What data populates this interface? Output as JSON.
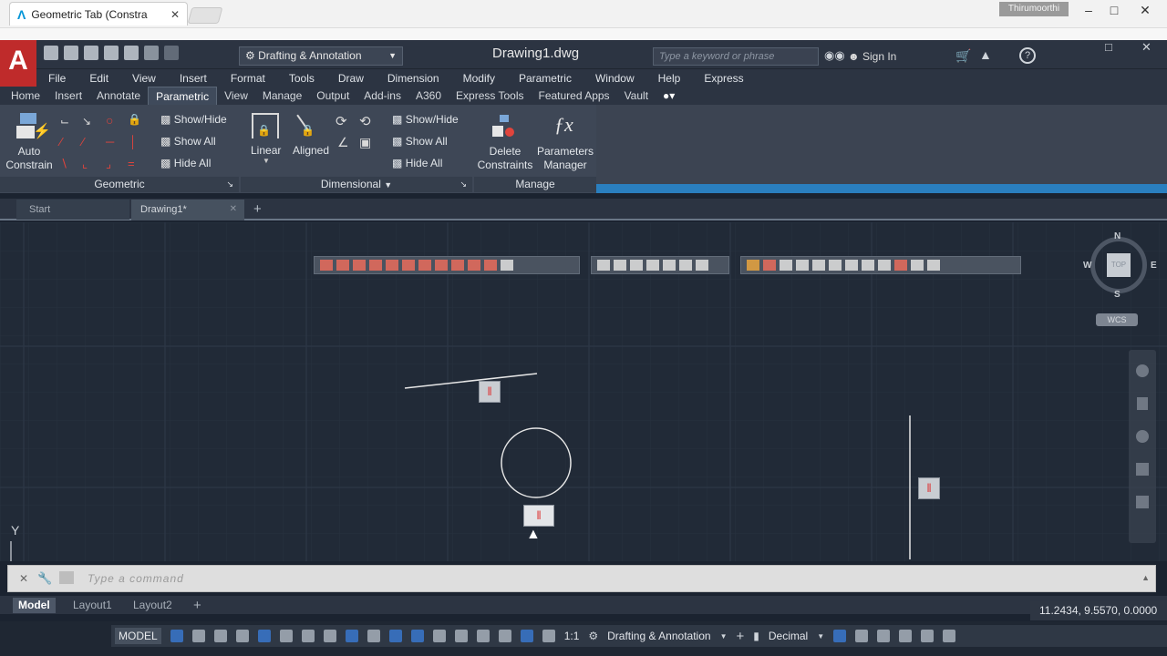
{
  "browser": {
    "tab_title": "Geometric Tab (Constra",
    "user": "Thirumoorthi"
  },
  "app": {
    "logo": "A",
    "workspace": "Drafting & Annotation",
    "document_title": "Drawing1.dwg",
    "search_placeholder": "Type a keyword or phrase",
    "sign_in": "Sign In"
  },
  "menu": [
    "File",
    "Edit",
    "View",
    "Insert",
    "Format",
    "Tools",
    "Draw",
    "Dimension",
    "Modify",
    "Parametric",
    "Window",
    "Help",
    "Express"
  ],
  "ribbon_tabs": [
    "Home",
    "Insert",
    "Annotate",
    "Parametric",
    "View",
    "Manage",
    "Output",
    "Add-ins",
    "A360",
    "Express Tools",
    "Featured Apps",
    "Vault"
  ],
  "active_ribbon_tab": "Parametric",
  "ribbon": {
    "geometric": {
      "auto_constrain": "Auto\nConstrain",
      "auto_line1": "Auto",
      "auto_line2": "Constrain",
      "show_hide": "Show/Hide",
      "show_all": "Show All",
      "hide_all": "Hide All",
      "title": "Geometric"
    },
    "dimensional": {
      "linear": "Linear",
      "aligned": "Aligned",
      "show_hide": "Show/Hide",
      "show_all": "Show All",
      "hide_all": "Hide All",
      "title": "Dimensional"
    },
    "manage": {
      "delete_line1": "Delete",
      "delete_line2": "Constraints",
      "params_line1": "Parameters",
      "params_line2": "Manager",
      "title": "Manage"
    }
  },
  "doc_tabs": {
    "start": "Start",
    "drawing": "Drawing1*"
  },
  "viewcube": {
    "north": "N",
    "south": "S",
    "east": "E",
    "west": "W",
    "top": "TOP",
    "wcs": "WCS"
  },
  "ucs": {
    "y": "Y"
  },
  "command": {
    "placeholder": "Type a command"
  },
  "layout_tabs": [
    "Model",
    "Layout1",
    "Layout2"
  ],
  "coordinates": "11.2434, 9.5570, 0.0000",
  "status": {
    "model": "MODEL",
    "scale": "1:1",
    "workspace": "Drafting & Annotation",
    "units": "Decimal"
  }
}
